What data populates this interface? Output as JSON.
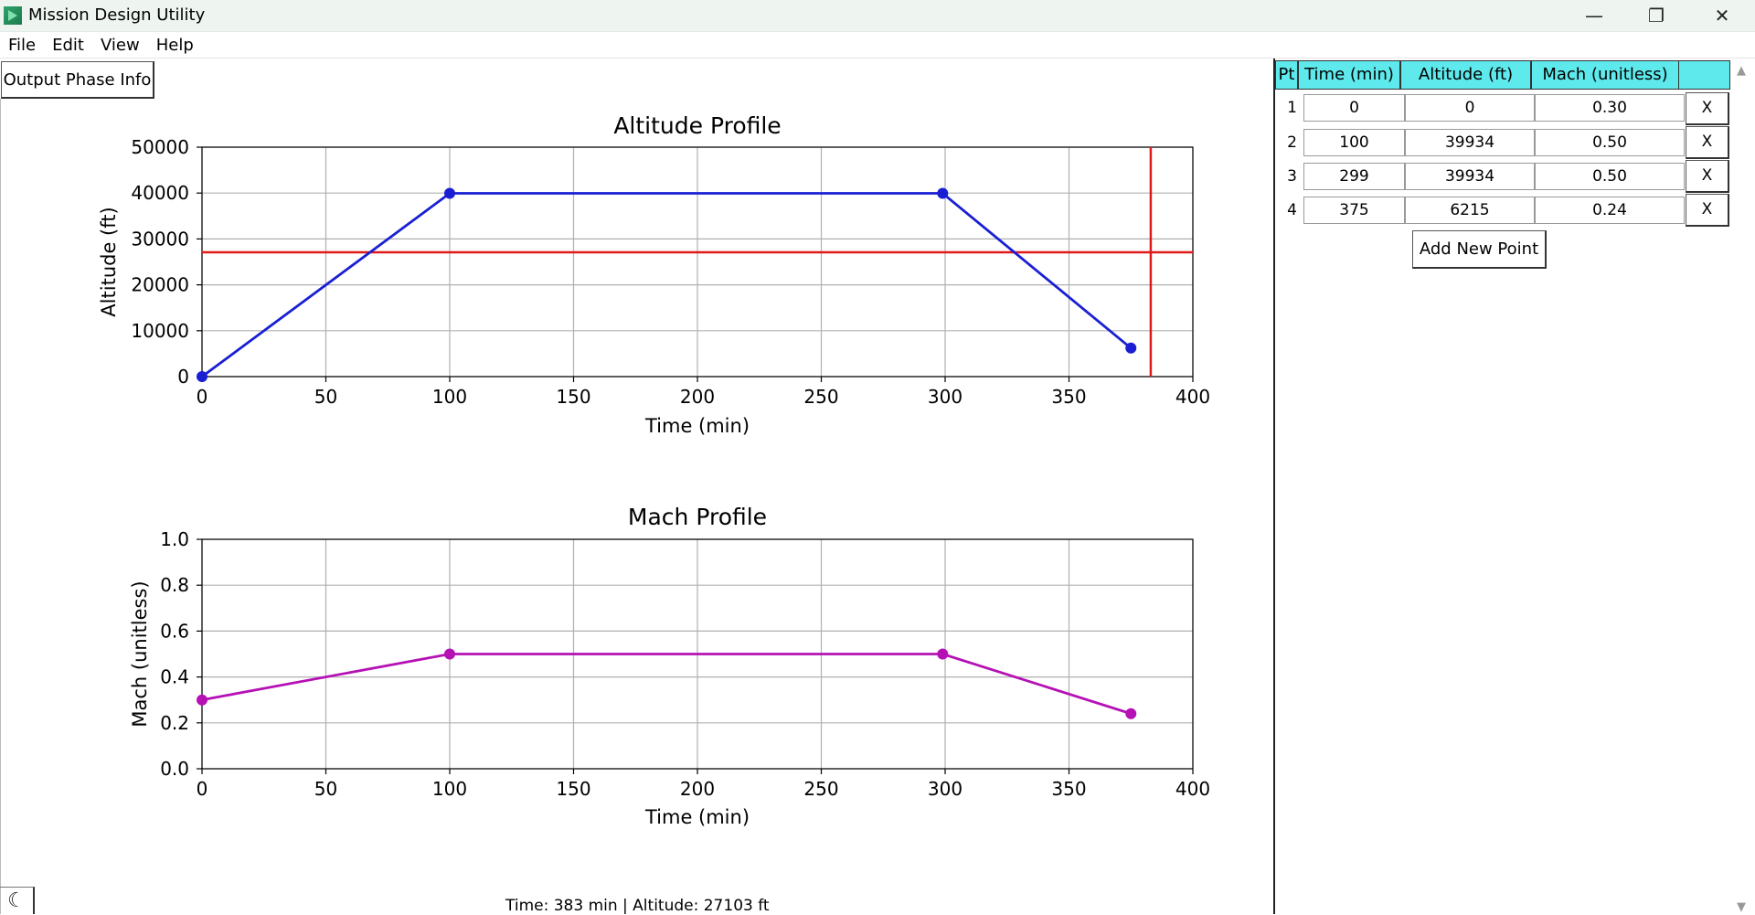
{
  "window": {
    "title": "Mission Design Utility",
    "minimize": "—",
    "maximize": "❐",
    "close": "✕"
  },
  "menu": [
    "File",
    "Edit",
    "View",
    "Help"
  ],
  "output_button": "Output Phase Info",
  "status": "Time: 383 min | Altitude: 27103 ft",
  "theme_icon": "☾",
  "table": {
    "headers": [
      "Pt",
      "Time (min)",
      "Altitude (ft)",
      "Mach (unitless)"
    ],
    "rows": [
      {
        "pt": "1",
        "time": "0",
        "alt": "0",
        "mach": "0.30",
        "del": "X"
      },
      {
        "pt": "2",
        "time": "100",
        "alt": "39934",
        "mach": "0.50",
        "del": "X"
      },
      {
        "pt": "3",
        "time": "299",
        "alt": "39934",
        "mach": "0.50",
        "del": "X"
      },
      {
        "pt": "4",
        "time": "375",
        "alt": "6215",
        "mach": "0.24",
        "del": "X"
      }
    ],
    "add_button": "Add New Point"
  },
  "chart_data": [
    {
      "type": "line",
      "title": "Altitude Profile",
      "xlabel": "Time (min)",
      "ylabel": "Altitude (ft)",
      "xlim": [
        0,
        400
      ],
      "ylim": [
        0,
        50000
      ],
      "xticks": [
        0,
        50,
        100,
        150,
        200,
        250,
        300,
        350,
        400
      ],
      "yticks": [
        0,
        10000,
        20000,
        30000,
        40000,
        50000
      ],
      "grid": true,
      "color": "#1a1fd4",
      "x": [
        0,
        100,
        299,
        375
      ],
      "y": [
        0,
        39934,
        39934,
        6215
      ],
      "crosshair": {
        "x": 383,
        "y": 27103,
        "color": "#e01a1a"
      }
    },
    {
      "type": "line",
      "title": "Mach Profile",
      "xlabel": "Time (min)",
      "ylabel": "Mach (unitless)",
      "xlim": [
        0,
        400
      ],
      "ylim": [
        0,
        1.0
      ],
      "xticks": [
        0,
        50,
        100,
        150,
        200,
        250,
        300,
        350,
        400
      ],
      "yticks": [
        0.0,
        0.2,
        0.4,
        0.6,
        0.8,
        1.0
      ],
      "ytick_labels": [
        "0.0",
        "0.2",
        "0.4",
        "0.6",
        "0.8",
        "1.0"
      ],
      "grid": true,
      "color": "#b511b5",
      "x": [
        0,
        100,
        299,
        375
      ],
      "y": [
        0.3,
        0.5,
        0.5,
        0.24
      ]
    }
  ]
}
